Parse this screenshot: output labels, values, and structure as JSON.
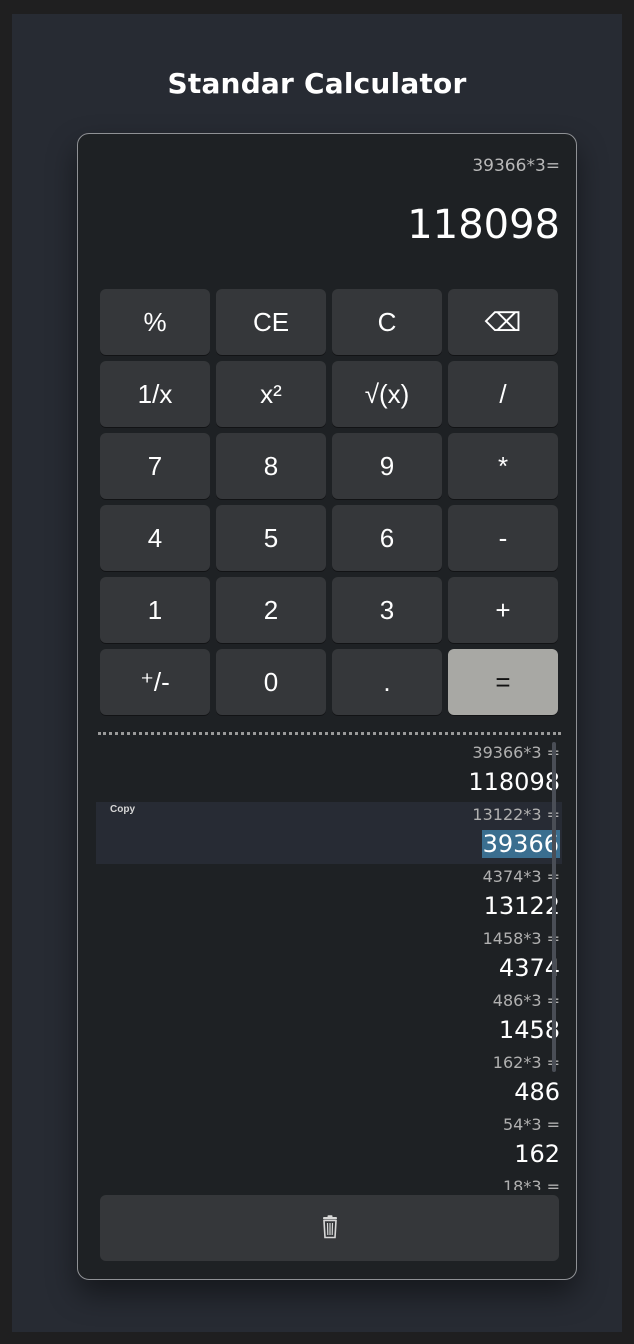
{
  "app": {
    "title": "Standar Calculator"
  },
  "display": {
    "expression": "39366*3=",
    "value": "118098"
  },
  "keys": [
    {
      "label": "%",
      "name": "percent-key"
    },
    {
      "label": "CE",
      "name": "clear-entry-key"
    },
    {
      "label": "C",
      "name": "clear-key"
    },
    {
      "label": "⌫",
      "name": "backspace-key"
    },
    {
      "label": "1/x",
      "name": "reciprocal-key"
    },
    {
      "label": "x²",
      "name": "square-key"
    },
    {
      "label": "√(x)",
      "name": "square-root-key"
    },
    {
      "label": "/",
      "name": "divide-key"
    },
    {
      "label": "7",
      "name": "digit-7-key"
    },
    {
      "label": "8",
      "name": "digit-8-key"
    },
    {
      "label": "9",
      "name": "digit-9-key"
    },
    {
      "label": "*",
      "name": "multiply-key"
    },
    {
      "label": "4",
      "name": "digit-4-key"
    },
    {
      "label": "5",
      "name": "digit-5-key"
    },
    {
      "label": "6",
      "name": "digit-6-key"
    },
    {
      "label": "-",
      "name": "subtract-key"
    },
    {
      "label": "1",
      "name": "digit-1-key"
    },
    {
      "label": "2",
      "name": "digit-2-key"
    },
    {
      "label": "3",
      "name": "digit-3-key"
    },
    {
      "label": "+",
      "name": "add-key"
    },
    {
      "label": "⁺/-",
      "name": "negate-key"
    },
    {
      "label": "0",
      "name": "digit-0-key"
    },
    {
      "label": ".",
      "name": "decimal-key"
    },
    {
      "label": "=",
      "name": "equals-key"
    }
  ],
  "history": {
    "copy_label": "Copy",
    "items": [
      {
        "expression": "39366*3 =",
        "result": "118098"
      },
      {
        "expression": "13122*3 =",
        "result": "39366",
        "selected": true
      },
      {
        "expression": "4374*3 =",
        "result": "13122"
      },
      {
        "expression": "1458*3 =",
        "result": "4374"
      },
      {
        "expression": "486*3 =",
        "result": "1458"
      },
      {
        "expression": "162*3 =",
        "result": "486"
      },
      {
        "expression": "54*3 =",
        "result": "162"
      },
      {
        "expression": "18*3 =",
        "result": ""
      }
    ]
  },
  "actions": {
    "clear_history_icon": "trash-icon"
  },
  "colors": {
    "background": "#272b33",
    "panel": "#1e2124",
    "key": "#35373a",
    "equals_key": "#a8a8a4",
    "selection_highlight": "#3a6e8f"
  }
}
